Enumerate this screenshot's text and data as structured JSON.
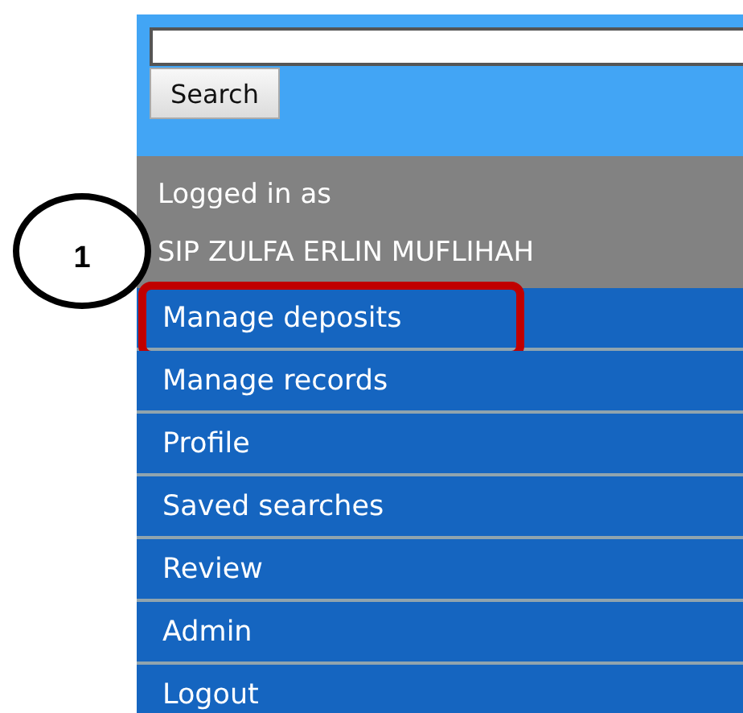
{
  "search": {
    "button": "Search"
  },
  "user": {
    "label": "Logged in as",
    "name": "SIP ZULFA ERLIN MUFLIHAH"
  },
  "menu": [
    {
      "label": "Manage deposits",
      "highlighted": true
    },
    {
      "label": "Manage records",
      "highlighted": false
    },
    {
      "label": "Profile",
      "highlighted": false
    },
    {
      "label": "Saved searches",
      "highlighted": false
    },
    {
      "label": "Review",
      "highlighted": false
    },
    {
      "label": "Admin",
      "highlighted": false
    },
    {
      "label": "Logout",
      "highlighted": false
    }
  ],
  "callout": {
    "number": "1"
  }
}
